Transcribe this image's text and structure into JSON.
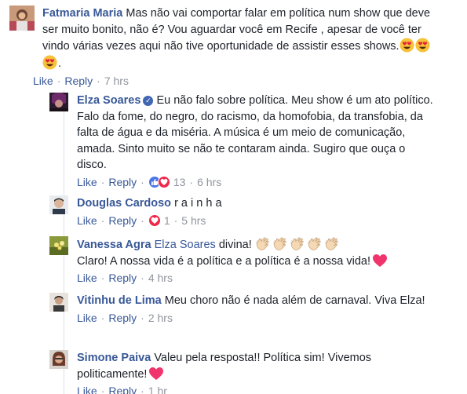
{
  "comments": [
    {
      "author": "Fatmaria Maria",
      "text": "Mas não vai comportar falar em política num show que deve ser muito bonito, não é? Vou aguardar você em Recife , apesar de você ter vindo várias vezes aqui não tive oportunidade de assistir esses shows.",
      "like": "Like",
      "reply": "Reply",
      "time": "7 hrs"
    }
  ],
  "replies": [
    {
      "author": "Elza Soares",
      "text": "Eu não falo sobre política. Meu show é um ato político. Falo da fome, do negro, do racismo, da homofobia, da transfobia, da falta de água e da miséria. A música é um meio de comunicação, amada. Sinto muito se não te contaram ainda. Sugiro que ouça o disco.",
      "like": "Like",
      "reply": "Reply",
      "reaction_count": "13",
      "time": "6 hrs"
    },
    {
      "author": "Douglas Cardoso",
      "text": "r a i n h a",
      "like": "Like",
      "reply": "Reply",
      "reaction_count": "1",
      "time": "5 hrs"
    },
    {
      "author": "Vanessa Agra",
      "mention": "Elza Soares",
      "text": "divina!",
      "text2": "Claro! A nossa vida é a política e a política é a nossa vida!",
      "like": "Like",
      "reply": "Reply",
      "time": "4 hrs"
    },
    {
      "author": "Vitinhu de Lima",
      "text": "Meu choro não é nada além de carnaval. Viva Elza!",
      "like": "Like",
      "reply": "Reply",
      "time": "2 hrs"
    },
    {
      "author": "Simone Paiva",
      "text": "Valeu pela resposta!! Política sim! Vivemos politicamente!",
      "like": "Like",
      "reply": "Reply",
      "time": "1 hr"
    }
  ],
  "colors": {
    "link": "#385898",
    "meta": "#90949c",
    "like_reaction": "#4a76e8",
    "love_reaction": "#f0284a"
  },
  "icons": [
    "heart-eyes-emoji",
    "verified-badge-icon",
    "like-reaction-icon",
    "love-reaction-icon",
    "clapping-hands-emoji",
    "heart-emoji"
  ]
}
